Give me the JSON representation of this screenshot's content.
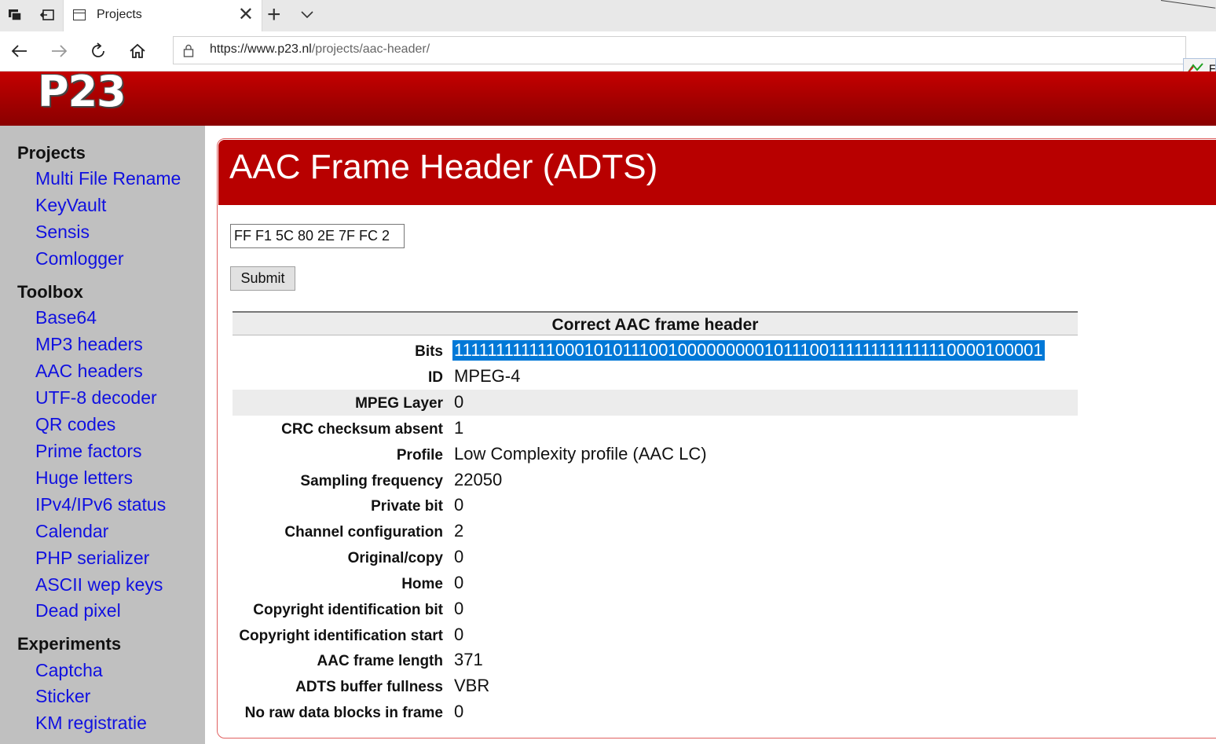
{
  "browser": {
    "tab_title": "Projects",
    "url_host": "https://www.p23.nl",
    "url_path": "/projects/aac-header/",
    "ext_label": "Fa"
  },
  "site": {
    "logo": "P23",
    "accent_color": "#b80000",
    "sidebar_color": "#c0c0c0",
    "link_color": "#1010e0"
  },
  "sidebar": {
    "sections": [
      {
        "heading": "Projects",
        "items": [
          "Multi File Rename",
          "KeyVault",
          "Sensis",
          "Comlogger"
        ]
      },
      {
        "heading": "Toolbox",
        "items": [
          "Base64",
          "MP3 headers",
          "AAC headers",
          "UTF-8 decoder",
          "QR codes",
          "Prime factors",
          "Huge letters",
          "IPv4/IPv6 status",
          "Calendar",
          "PHP serializer",
          "ASCII wep keys",
          "Dead pixel"
        ]
      },
      {
        "heading": "Experiments",
        "items": [
          "Captcha",
          "Sticker",
          "KM registratie"
        ]
      }
    ]
  },
  "main": {
    "title": "AAC Frame Header (ADTS)",
    "input_value": "FF F1 5C 80 2E 7F FC 2",
    "submit_label": "Submit",
    "table_title": "Correct AAC frame header",
    "rows": [
      {
        "label": "Bits",
        "value": "11111111111100010101110010000000001011100111111111111110000100001"
      },
      {
        "label": "ID",
        "value": "MPEG-4"
      },
      {
        "label": "MPEG Layer",
        "value": "0"
      },
      {
        "label": "CRC checksum absent",
        "value": "1"
      },
      {
        "label": "Profile",
        "value": "Low Complexity profile (AAC LC)"
      },
      {
        "label": "Sampling frequency",
        "value": "22050"
      },
      {
        "label": "Private bit",
        "value": "0"
      },
      {
        "label": "Channel configuration",
        "value": "2"
      },
      {
        "label": "Original/copy",
        "value": "0"
      },
      {
        "label": "Home",
        "value": "0"
      },
      {
        "label": "Copyright identification bit",
        "value": "0"
      },
      {
        "label": "Copyright identification start",
        "value": "0"
      },
      {
        "label": "AAC frame length",
        "value": "371"
      },
      {
        "label": "ADTS buffer fullness",
        "value": "VBR"
      },
      {
        "label": "No raw data blocks in frame",
        "value": "0"
      }
    ]
  }
}
